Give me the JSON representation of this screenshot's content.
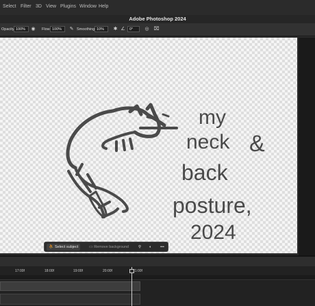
{
  "menubar": {
    "items": [
      "Select",
      "Filter",
      "3D",
      "View",
      "Plugins",
      "Window",
      "Help"
    ]
  },
  "window": {
    "title": "Adobe Photoshop 2024"
  },
  "options_bar": {
    "opacity_label": "Opacity:",
    "opacity_value": "100%",
    "flow_label": "Flow:",
    "flow_value": "100%",
    "smoothing_label": "Smoothing:",
    "smoothing_value": "10%",
    "angle_value": "0°",
    "icons": [
      "airbrush-icon",
      "pressure-opacity-icon",
      "settings-gear-icon",
      "angle-icon",
      "pressure-size-icon",
      "symmetry-icon"
    ]
  },
  "canvas": {
    "artwork_text": [
      "my",
      "neck",
      "&",
      "back",
      "posture,",
      "2024"
    ],
    "stroke_color": "#4a4a4a"
  },
  "contextual_taskbar": {
    "select_subject_label": "Select subject",
    "remove_background_label": "Remove background",
    "more_label": "•••"
  },
  "timeline": {
    "timecodes": [
      "17:00f",
      "18:00f",
      "19:00f",
      "20:00f",
      "21:00f"
    ]
  }
}
